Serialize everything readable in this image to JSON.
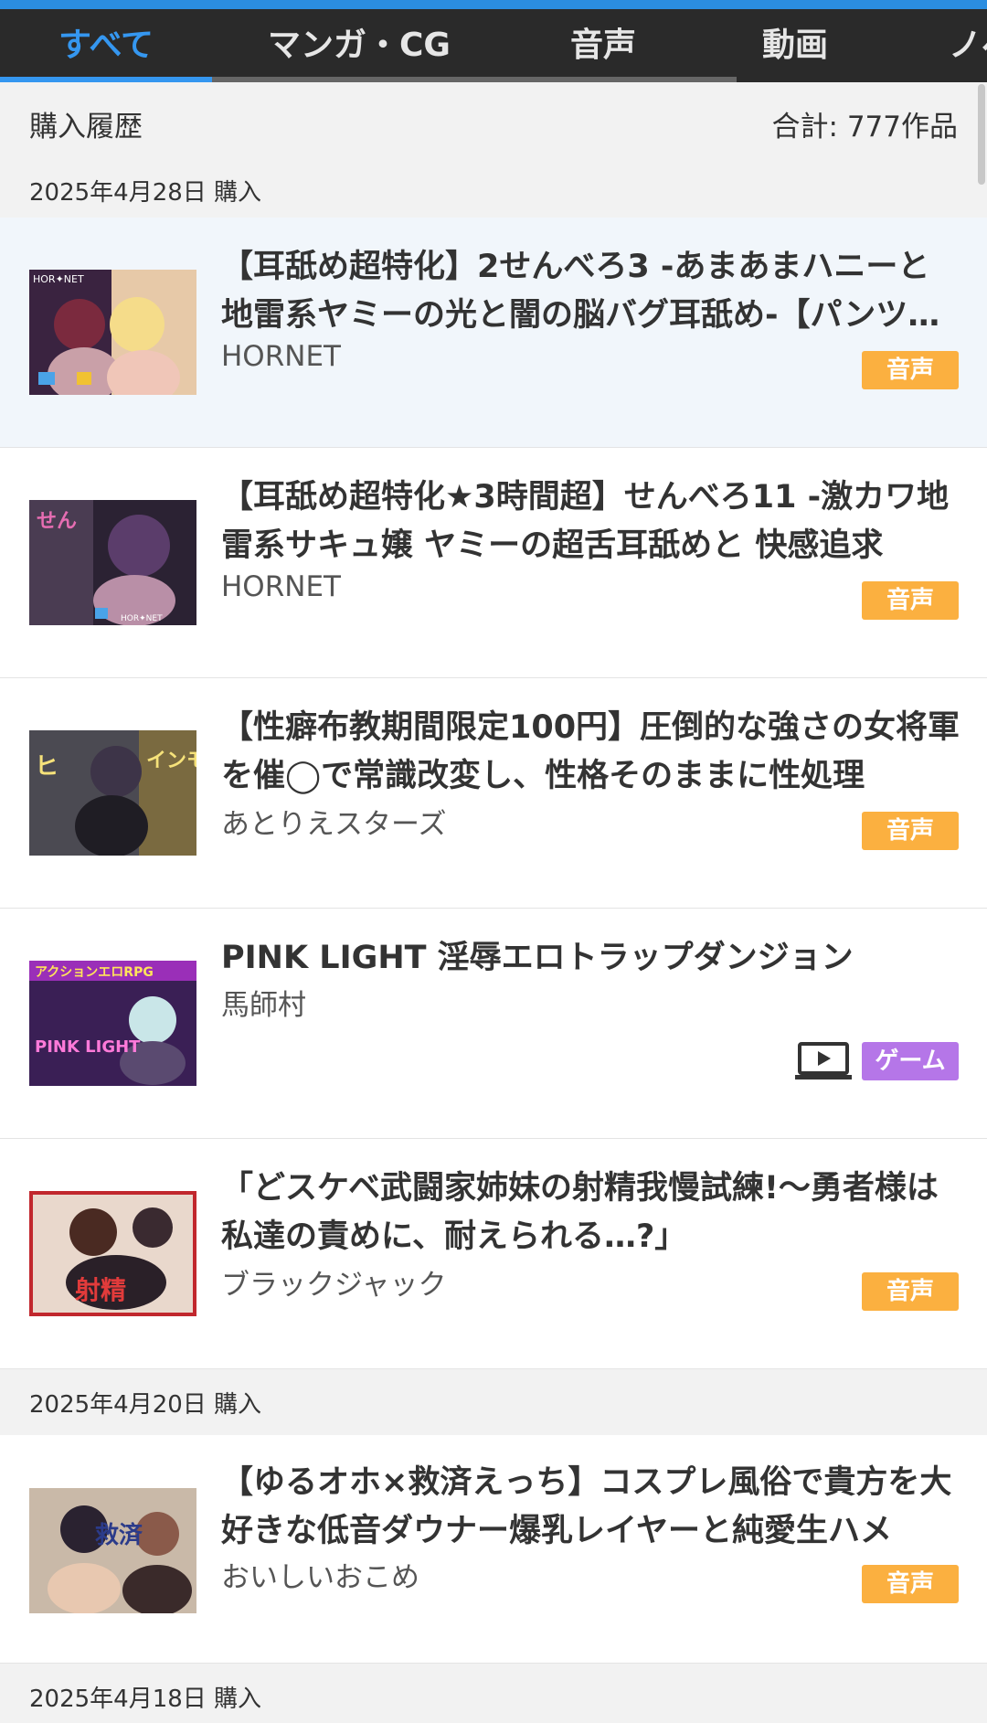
{
  "tabs": [
    {
      "label": "すべて",
      "active": true
    },
    {
      "label": "マンガ・CG",
      "active": false
    },
    {
      "label": "音声",
      "active": false
    },
    {
      "label": "動画",
      "active": false
    },
    {
      "label": "ノベル",
      "active": false
    }
  ],
  "header": {
    "title": "購入履歴",
    "total": "合計: 777作品"
  },
  "sections": [
    {
      "date": "2025年4月28日 購入"
    },
    {
      "date": "2025年4月20日 購入"
    },
    {
      "date": "2025年4月18日 購入"
    }
  ],
  "items": [
    {
      "title": "【耳舐め超特化】2せんべろ3 -あまあまハニーと地雷系ヤミーの光と闇の脳バグ耳舐め-【パンツ穿き替え】",
      "circle": "HORNET",
      "category": "音声",
      "thumb_text": "HOR✦NET"
    },
    {
      "title": "【耳舐め超特化★3時間超】せんべろ11 -激カワ地雷系サキュ嬢 ヤミーの超舌耳舐めと 快感追求",
      "circle": "HORNET",
      "category": "音声",
      "thumb_text": "HOR✦NET"
    },
    {
      "title": "【性癖布教期間限定100円】圧倒的な強さの女将軍を催◯で常識改変し、性格そのままに性処理",
      "circle": "あとりえスターズ",
      "category": "音声",
      "thumb_text": "インモラル"
    },
    {
      "title": "PINK LIGHT 淫辱エロトラップダンジョン",
      "circle": "馬師村",
      "category": "ゲーム",
      "thumb_text": "PINK LIGHT"
    },
    {
      "title": "「どスケベ武闘家姉妹の射精我慢試練!〜勇者様は私達の責めに、耐えられる…?」",
      "circle": "ブラックジャック",
      "category": "音声",
      "thumb_text": "射精"
    },
    {
      "title": "【ゆるオホ×救済えっち】コスプレ風俗で貴方を大好きな低音ダウナー爆乳レイヤーと純愛生ハメ",
      "circle": "おいしいおこめ",
      "category": "音声",
      "thumb_text": "救済"
    }
  ],
  "icons": {
    "video": "play-screen-icon"
  },
  "colors": {
    "accent": "#3597f0",
    "voice_badge": "#fbb040",
    "game_badge": "#b576e8"
  }
}
